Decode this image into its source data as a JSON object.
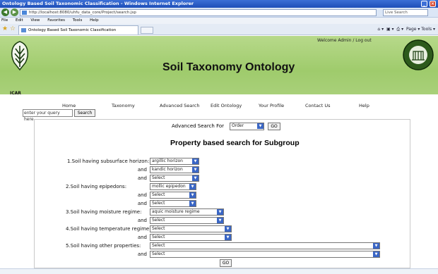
{
  "window": {
    "title": "Ontology Based Soil Taxonomic Classification - Windows Internet Explorer"
  },
  "browser": {
    "address": "http://localhost:8080/uhfu_data_core/Project/search.jsp",
    "search_placeholder": "Live Search",
    "menu": [
      "File",
      "Edit",
      "View",
      "Favorites",
      "Tools",
      "Help"
    ],
    "tab_title": "Ontology Based Soil Taxonomic Classification",
    "tools": "Page ▾  Tools ▾"
  },
  "site": {
    "title": "Soil Taxonomy Ontology",
    "welcome": "Welcome Admin / Log out",
    "icar_text": "ICAR",
    "nav": [
      "Home",
      "Taxonomy",
      "Advanced Search",
      "Edit Ontology",
      "Your Profile",
      "Contact Us",
      "Help"
    ],
    "query_placeholder": "enter your query here...",
    "search_button": "Search"
  },
  "advanced": {
    "label": "Advanced Search For",
    "selected": "Order",
    "go": "GO"
  },
  "form": {
    "heading": "Property based search for Subgroup",
    "and": "and",
    "go": "GO",
    "q1_label": "1.Soil having subsurface horizon:",
    "q1_values": [
      "argillic horizon",
      "kandic horizon",
      "Select"
    ],
    "q2_label": "2.Soil having epipedons:",
    "q2_values": [
      "mollic epipedon",
      "Select",
      "Select"
    ],
    "q3_label": "3.Soil having moisture regime:",
    "q3_values": [
      "aquic moisture regime",
      "Select"
    ],
    "q4_label": "4.Soil having temperature regime:",
    "q4_values": [
      "Select",
      "Select"
    ],
    "q5_label": "5.Soil having other properties:",
    "q5_values": [
      "Select",
      "Select"
    ]
  },
  "colors": {
    "header_green": "#a6d077",
    "select_arrow": "#3a66c5",
    "titlebar": "#2a5cc6"
  }
}
